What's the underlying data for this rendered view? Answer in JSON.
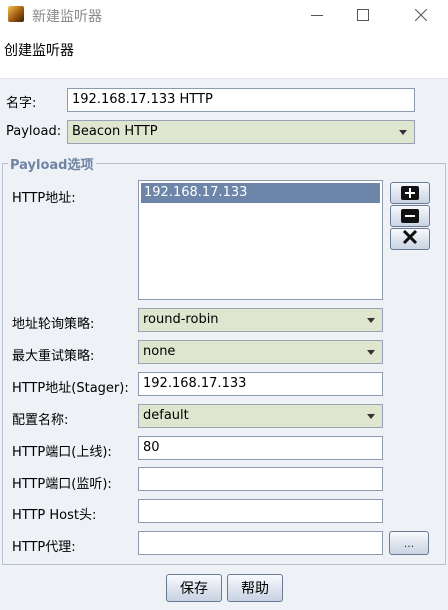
{
  "window": {
    "title": "新建监听器"
  },
  "header": {
    "text": "创建监听器"
  },
  "form": {
    "name_label": "名字:",
    "name_value": "192.168.17.133 HTTP",
    "payload_label": "Payload:",
    "payload_value": "Beacon HTTP"
  },
  "options": {
    "legend": "Payload选项",
    "http_hosts_label": "HTTP地址:",
    "http_hosts": [
      "192.168.17.133"
    ],
    "rotate_label": "地址轮询策略:",
    "rotate_value": "round-robin",
    "retry_label": "最大重试策略:",
    "retry_value": "none",
    "stager_label": "HTTP地址(Stager):",
    "stager_value": "192.168.17.133",
    "profile_label": "配置名称:",
    "profile_value": "default",
    "port_c2_label": "HTTP端口(上线):",
    "port_c2_value": "80",
    "port_bind_label": "HTTP端口(监听):",
    "port_bind_value": "",
    "host_header_label": "HTTP Host头:",
    "host_header_value": "",
    "proxy_label": "HTTP代理:",
    "proxy_value": "",
    "proxy_button": "..."
  },
  "footer": {
    "save": "保存",
    "help": "帮助"
  },
  "icons": {
    "app": "beacon-app-icon",
    "add": "plus-icon",
    "remove": "minus-icon",
    "clear": "x-icon",
    "dropdown": "chevron-down-icon"
  }
}
